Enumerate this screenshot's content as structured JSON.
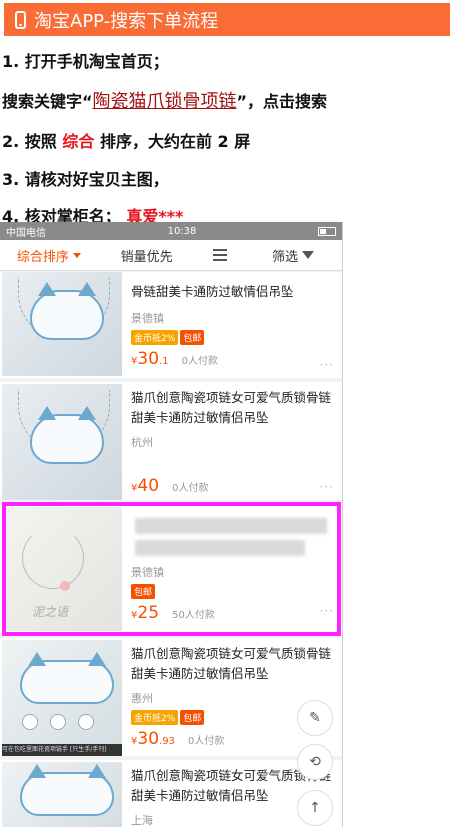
{
  "doc": {
    "header_title": "淘宝APP-搜索下单流程",
    "step1": "1. 打开手机淘宝首页；",
    "step2_prefix": "搜索关键字“",
    "step2_keyword": "陶瓷猫爪锁骨项链",
    "step2_suffix": "”，点击搜索",
    "step3_prefix": "2. 按照",
    "step3_highlight": "综合",
    "step3_suffix": "排序，大约在前 2 屏",
    "step4": "3. 请核对好宝贝主图，",
    "step5_prefix": "4. 核对掌柜名；",
    "step5_highlight": "真爱***"
  },
  "status": {
    "carrier": "中国电信",
    "time": "10:38"
  },
  "sort_tabs": [
    {
      "label": "综合排序"
    },
    {
      "label": "销量优先"
    },
    {
      "label": ""
    },
    {
      "label": "筛选"
    }
  ],
  "items": [
    {
      "title": "骨链甜美卡通防过敏情侣吊坠",
      "location": "景德镇",
      "coin": "金币抵2%",
      "mail": "包邮",
      "price_int": "30",
      "price_dec": ".1",
      "paid": "0人付款"
    },
    {
      "title": "猫爪创意陶瓷项链女可爱气质锁骨链甜美卡通防过敏情侣吊坠",
      "location": "杭州",
      "price_int": "40",
      "paid": "0人付款"
    },
    {
      "location": "景德镇",
      "mail": "包邮",
      "price_int": "25",
      "paid": "50人付款",
      "img_text": "泥之语"
    },
    {
      "title": "猫爪创意陶瓷项链女可爱气质锁骨链甜美卡通防过敏情侣吊坠",
      "location": "惠州",
      "coin": "金币抵2%",
      "mail": "包邮",
      "price_int": "30",
      "price_dec": ".93",
      "paid": "0人付款",
      "img_caption": "可在包吃里面花瓷项链手 [只生手/手刊]"
    },
    {
      "title": "猫爪创意陶瓷项链女可爱气质锁骨链甜美卡通防过敏情侣吊坠",
      "location": "上海"
    }
  ],
  "currency": "¥",
  "more": "···",
  "colors": {
    "accent": "#f55000",
    "highlight_box": "#ff24ff",
    "header_bg": "#f96c35"
  }
}
